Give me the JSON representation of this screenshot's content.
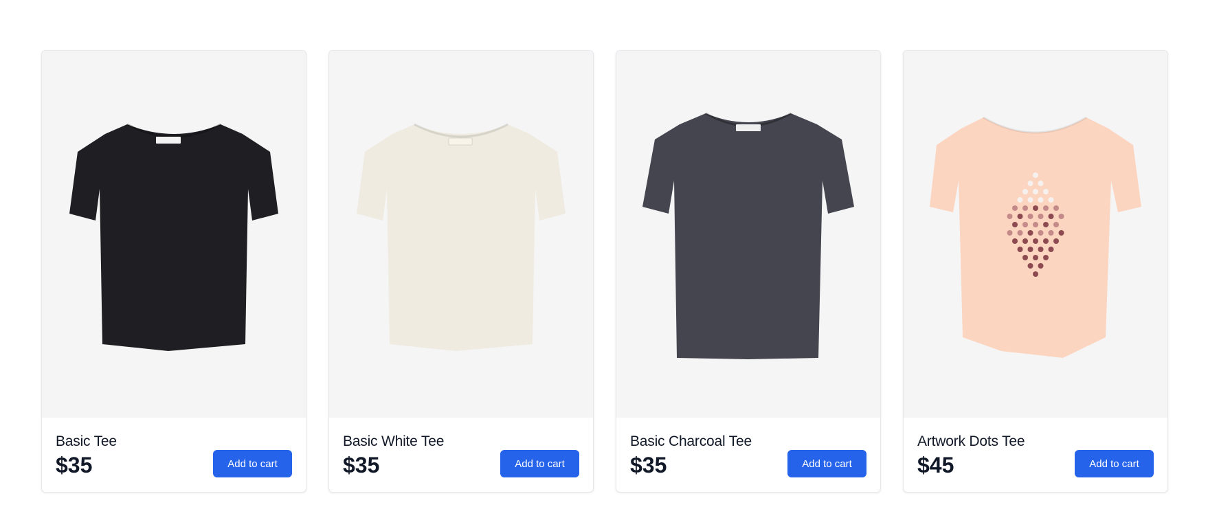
{
  "products": [
    {
      "name": "Basic Tee",
      "price": "$35",
      "button_label": "Add to cart",
      "shirt_color": "#1f1f23",
      "label_color": "#f3f3f3"
    },
    {
      "name": "Basic White Tee",
      "price": "$35",
      "button_label": "Add to cart",
      "shirt_color": "#efebe0",
      "label_color": "#f8f4ea"
    },
    {
      "name": "Basic Charcoal Tee",
      "price": "$35",
      "button_label": "Add to cart",
      "shirt_color": "#45454f",
      "label_color": "#eeeeee"
    },
    {
      "name": "Artwork Dots Tee",
      "price": "$45",
      "button_label": "Add to cart",
      "shirt_color": "#fcd5c0",
      "label_color": "#fcd5c0"
    }
  ],
  "colors": {
    "accent": "#2563eb",
    "image_background": "#f5f5f6",
    "dot_light": "#f6f1ef",
    "dot_mid": "#c48a8a",
    "dot_dark": "#8d4a50"
  }
}
